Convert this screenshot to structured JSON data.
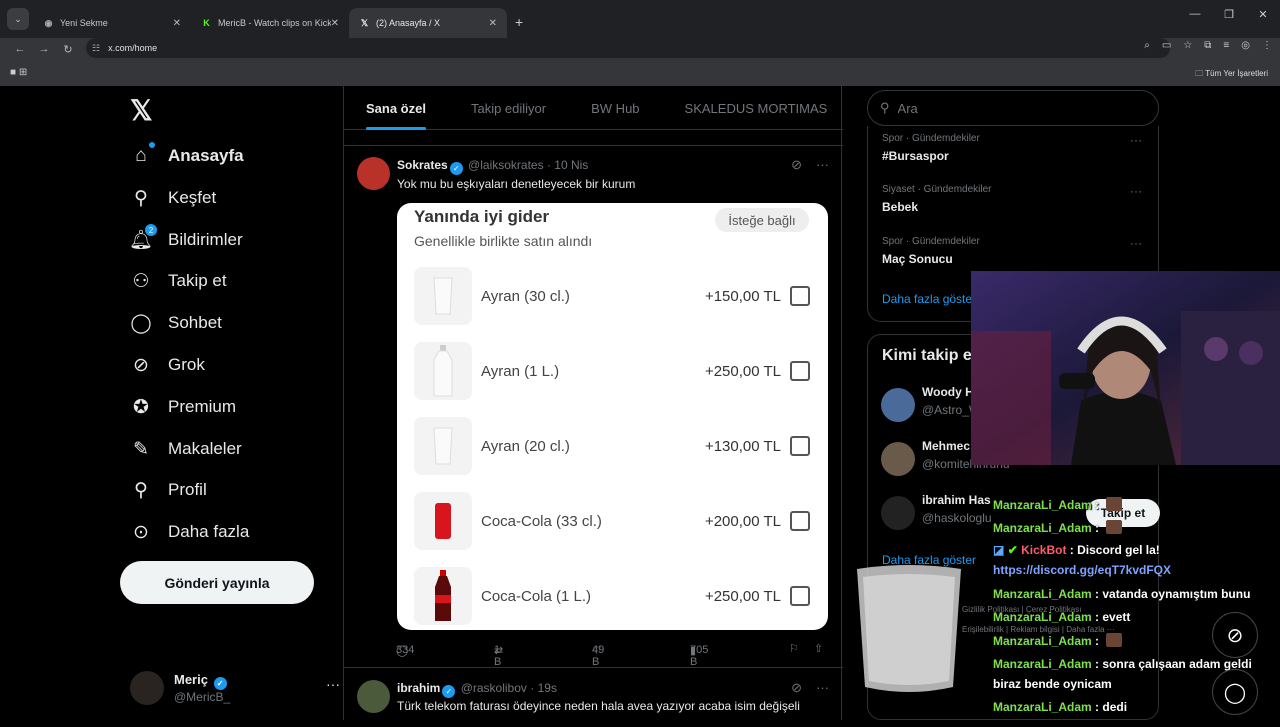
{
  "browser": {
    "tabs": [
      {
        "title": "Yeni Sekme",
        "favicon": "chrome-icon"
      },
      {
        "title": "MericB - Watch clips on Kick",
        "favicon": "kick-icon"
      },
      {
        "title": "(2) Anasayfa / X",
        "favicon": "x-icon"
      }
    ],
    "url": "x.com/home",
    "bookmarks_label": "Tüm Yer İşaretleri"
  },
  "nav": {
    "items": [
      {
        "label": "Anasayfa",
        "icon": "home-icon"
      },
      {
        "label": "Keşfet",
        "icon": "search-icon"
      },
      {
        "label": "Bildirimler",
        "icon": "bell-icon",
        "badge": "2"
      },
      {
        "label": "Takip et",
        "icon": "add-user-icon"
      },
      {
        "label": "Sohbet",
        "icon": "chat-icon"
      },
      {
        "label": "Grok",
        "icon": "grok-icon"
      },
      {
        "label": "Premium",
        "icon": "verified-icon"
      },
      {
        "label": "Makaleler",
        "icon": "article-icon"
      },
      {
        "label": "Profil",
        "icon": "person-icon"
      },
      {
        "label": "Daha fazla",
        "icon": "more-circle-icon"
      }
    ],
    "post_button": "Gönderi yayınla",
    "account": {
      "name": "Meriç",
      "handle": "@MericB_"
    }
  },
  "feed": {
    "tabs": [
      "Sana özel",
      "Takip ediliyor",
      "BW Hub",
      "SKALEDUS MORTIMAS"
    ],
    "tweet1": {
      "name": "Sokrates",
      "handle": "@laiksokrates",
      "time": "10 Nis",
      "text": "Yok mu bu eşkıyaları denetleyecek bir kurum",
      "card": {
        "title": "Yanında iyi gider",
        "subtitle": "Genellikle birlikte satın alındı",
        "optional": "İsteğe bağlı",
        "items": [
          {
            "name": "Ayran (30 cl.)",
            "price": "+150,00 TL"
          },
          {
            "name": "Ayran (1 L.)",
            "price": "+250,00 TL"
          },
          {
            "name": "Ayran (20 cl.)",
            "price": "+130,00 TL"
          },
          {
            "name": "Coca-Cola (33 cl.)",
            "price": "+200,00 TL"
          },
          {
            "name": "Coca-Cola (1 L.)",
            "price": "+250,00 TL"
          }
        ]
      },
      "stats": {
        "replies": "334",
        "reposts": "1 B",
        "likes": "49 B",
        "views": "705 B"
      }
    },
    "tweet2": {
      "name": "ibrahim",
      "handle": "@raskolibov",
      "time": "19s",
      "text": "Türk telekom faturası ödeyince neden hala avea yazıyor acaba isim değişeli"
    }
  },
  "sidebar": {
    "search_placeholder": "Ara",
    "trends": [
      {
        "category": "Spor · Gündemdekiler",
        "name": "#Bursaspor"
      },
      {
        "category": "Siyaset · Gündemdekiler",
        "name": "Bebek"
      },
      {
        "category": "Spor · Gündemdekiler",
        "name": "Maç Sonucu"
      }
    ],
    "show_more": "Daha fazla göster",
    "who_to_follow": {
      "title": "Kimi takip e",
      "users": [
        {
          "name": "Woody H",
          "handle": "@Astro_W"
        },
        {
          "name": "Mehmec",
          "handle": "@komitehinrunu"
        },
        {
          "name": "ibrahim Has",
          "handle": "@haskologlu"
        }
      ],
      "follow_label": "Takip et",
      "show_more": "Daha fazla göster"
    },
    "footer": [
      "Gizlilik Politikası",
      "Çerez Politikası",
      "Erişilebilirlik",
      "Reklam bilgisi",
      "Daha fazla ···"
    ]
  },
  "stream_chat": {
    "messages": [
      {
        "user": "ManzaraLi_Adam",
        "text": ""
      },
      {
        "user": "ManzaraLi_Adam",
        "text": ""
      },
      {
        "user": "KickBot",
        "text": "Discord gel la!"
      },
      {
        "user": "",
        "text": "https://discord.gg/eqT7kvdFQX"
      },
      {
        "user": "ManzaraLi_Adam",
        "text": "vatanda oynamıştım bunu"
      },
      {
        "user": "ManzaraLi_Adam",
        "text": "evett"
      },
      {
        "user": "ManzaraLi_Adam",
        "text": ""
      },
      {
        "user": "ManzaraLi_Adam",
        "text": "sonra çalışaan adam geldi"
      },
      {
        "user": "",
        "text": "biraz bende oynicam"
      },
      {
        "user": "ManzaraLi_Adam",
        "text": "dedi"
      }
    ]
  },
  "colors": {
    "accent": "#1d9bf0",
    "chat_user": "#7fe04d",
    "kickbot": "#ff5a6e"
  }
}
